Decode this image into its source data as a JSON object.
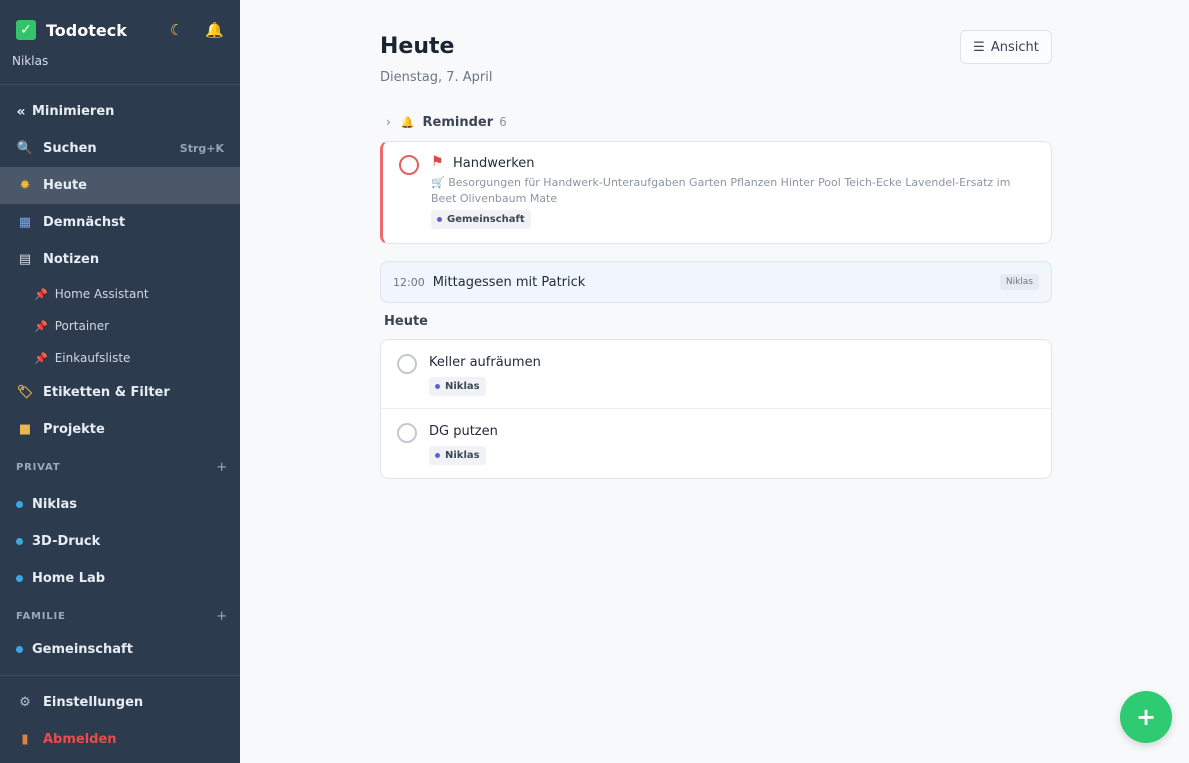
{
  "app": {
    "title": "Todoteck",
    "user": "Niklas"
  },
  "sidebar": {
    "collapse_label": "Minimieren",
    "search_label": "Suchen",
    "search_shortcut": "Strg+K",
    "items": [
      {
        "label": "Heute",
        "icon": "sun-icon"
      },
      {
        "label": "Demnächst",
        "icon": "calendar-icon"
      },
      {
        "label": "Notizen",
        "icon": "notes-icon"
      }
    ],
    "notes": [
      {
        "label": "Home Assistant"
      },
      {
        "label": "Portainer"
      },
      {
        "label": "Einkaufsliste"
      }
    ],
    "labels_filter": "Etiketten & Filter",
    "projects": "Projekte",
    "sections": [
      {
        "title": "PRIVAT",
        "projects": [
          "Niklas",
          "3D-Druck",
          "Home Lab"
        ]
      },
      {
        "title": "FAMILIE",
        "projects": [
          "Gemeinschaft"
        ]
      }
    ],
    "settings": "Einstellungen",
    "logout": "Abmelden"
  },
  "main": {
    "title": "Heute",
    "date": "Dienstag, 7. April",
    "view_button": "Ansicht",
    "reminder": {
      "label": "Reminder",
      "count": "6"
    },
    "flagged_task": {
      "title": "Handwerken",
      "description": "🛒 Besorgungen für Handwerk-Unteraufgaben Garten Pflanzen Hinter Pool Teich-Ecke Lavendel-Ersatz im Beet Olivenbaum Mate",
      "tag": "Gemeinschaft"
    },
    "event": {
      "time": "12:00",
      "title": "Mittagessen mit Patrick",
      "owner": "Niklas"
    },
    "section_title": "Heute",
    "tasks": [
      {
        "title": "Keller aufräumen",
        "tag": "Niklas"
      },
      {
        "title": "DG putzen",
        "tag": "Niklas"
      }
    ]
  },
  "fab_label": "+",
  "colors": {
    "sidebar_bg": "#2d3b4e",
    "accent_green": "#2fcb73",
    "flag_red": "#ef6b6b",
    "project_dot": "#3fa7e0"
  }
}
